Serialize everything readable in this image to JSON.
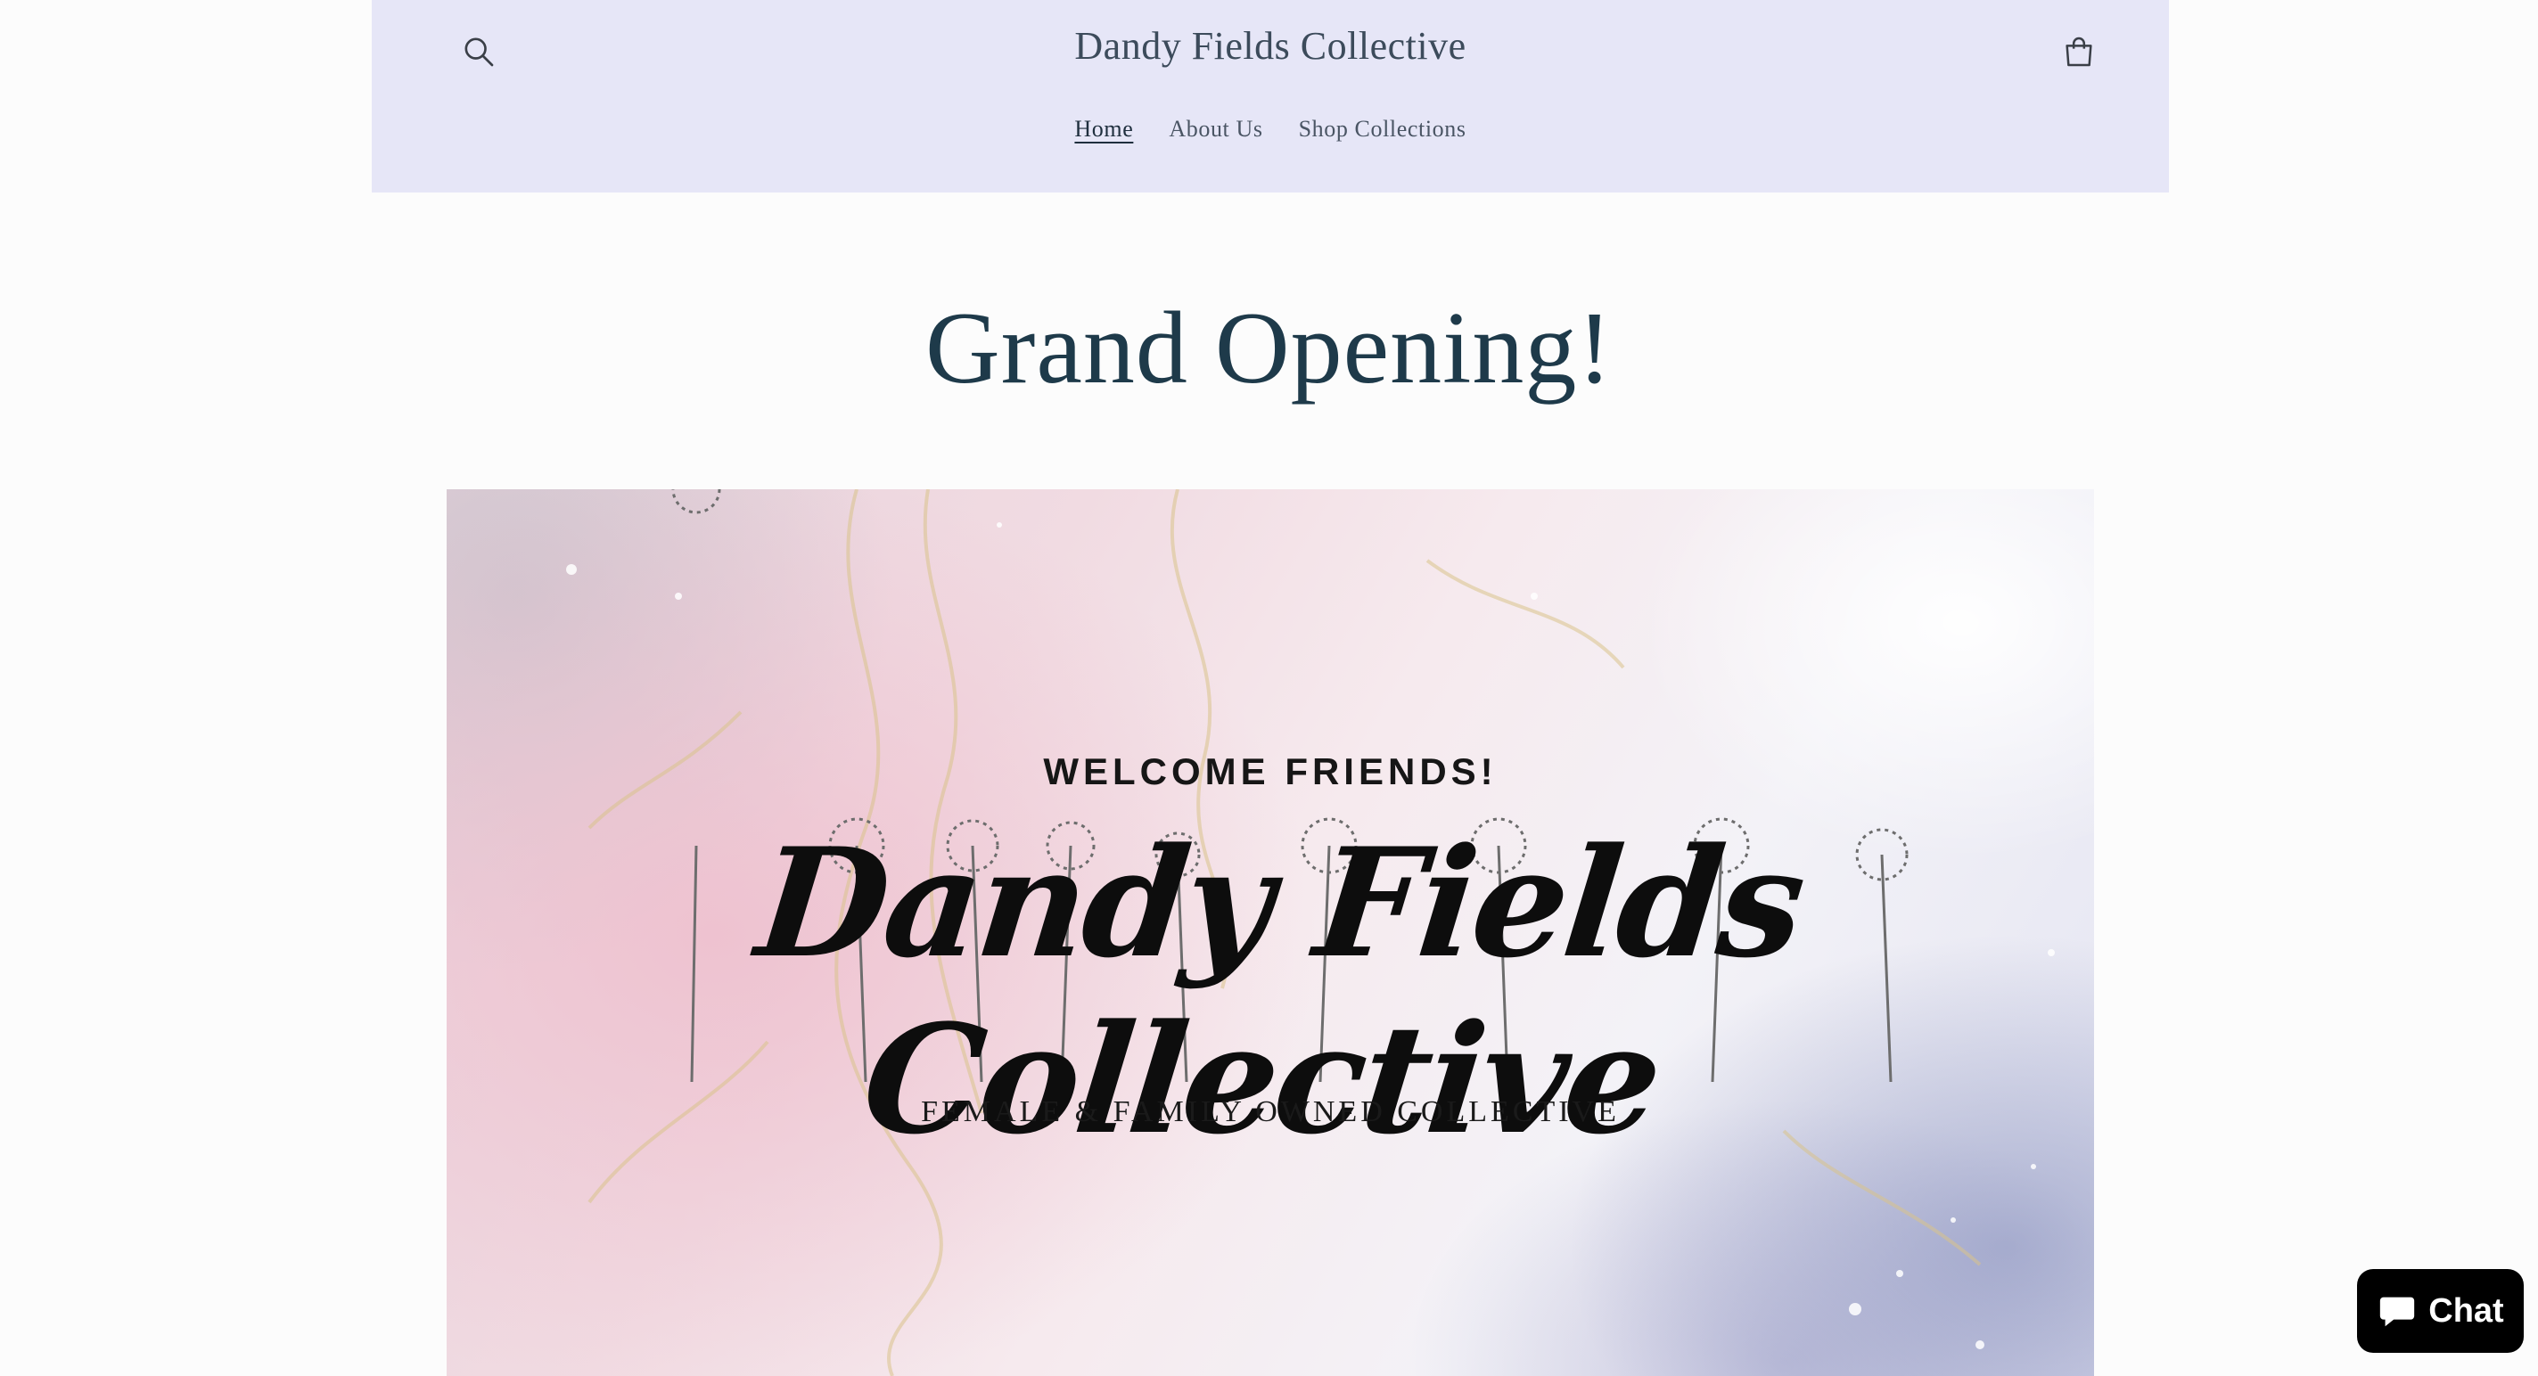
{
  "header": {
    "site_title": "Dandy Fields Collective",
    "search_icon": "search-icon",
    "cart_icon": "cart-icon",
    "nav": [
      {
        "label": "Home",
        "active": true
      },
      {
        "label": "About Us",
        "active": false
      },
      {
        "label": "Shop Collections",
        "active": false
      }
    ],
    "background_color": "#e6e6f7"
  },
  "main": {
    "heading": "Grand Opening!",
    "heading_color": "#1e3a4a",
    "banner": {
      "welcome": "WELCOME FRIENDS!",
      "script_title": "Dandy Fields Collective",
      "tagline": "FEMALE & FAMILY OWNED COLLECTIVE"
    }
  },
  "chat": {
    "label": "Chat",
    "icon": "chat-bubble-icon",
    "background_color": "#000000"
  }
}
